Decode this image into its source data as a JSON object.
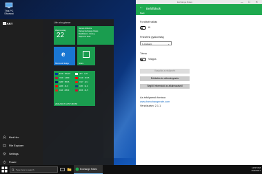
{
  "desktop": {
    "icon_label": "This PC Shortcut"
  },
  "start_menu": {
    "header": "START",
    "tiles_title": "Life at a glance",
    "bottom_items": [
      {
        "label": "Kimi Hrc",
        "icon": "user-icon"
      },
      {
        "label": "File Explorer",
        "icon": "folder-icon"
      },
      {
        "label": "Settings",
        "icon": "gear-icon"
      },
      {
        "label": "Power",
        "icon": "power-icon"
      }
    ],
    "tiles": {
      "calendar": {
        "day": "Wednesday",
        "num": "22"
      },
      "mail": {
        "lines": [
          "Nemes Hibernis",
          "Debug Exchange Rates",
          "Beállítások - Debug",
          "Rajz/szín 2011"
        ]
      },
      "edge": {
        "label": "Microsoft Edge"
      },
      "store": {
        "label": "Store"
      },
      "exchange": {
        "rows": [
          {
            "code": "EUR",
            "val": "309,23"
          },
          {
            "code": "USD",
            "val": "2,999"
          },
          {
            "code": "GBP",
            "val": "355,6"
          },
          {
            "code": "HRK",
            "val": "41,6"
          },
          {
            "code": "CHF",
            "val": "295,0"
          }
        ],
        "rows2": [
          {
            "code": "JPY",
            "val": "2,70"
          },
          {
            "code": "CAD",
            "val": "215,5"
          },
          {
            "code": "CNY",
            "val": "42,1"
          },
          {
            "code": "CZK",
            "val": "11,4"
          },
          {
            "code": "DKK",
            "val": "41,5"
          }
        ],
        "footer": "2021/2017 10:57:48 PM"
      }
    }
  },
  "window": {
    "titlebar": "Exchange Rates",
    "controls": [
      "—",
      "☐",
      "✕"
    ],
    "page_title": "Beállítások",
    "page_sub": "Back",
    "sections": {
      "toggle1_label": "Fordított váltás",
      "toggle1_state": "Ki",
      "select_label": "Frissítési gyakoriság",
      "select_value": "1 óránként",
      "theme_label": "Téma",
      "theme_state": "Világos",
      "btn_disabled": "Vásárlás a reklámért",
      "btn_rate": "Értékelés és véleményezés",
      "btn_help": "Segítő Információ az alkalmazásról",
      "about_title": "Az árfolyamok forrása",
      "about_link": "www.fxexchangerate.com",
      "version": "Verziószám: 2.1.1"
    }
  },
  "taskbar": {
    "search_placeholder": "Type here to search",
    "app_label": "Exchange Rates",
    "time": "10:57 PM",
    "date": "2/22/2017"
  }
}
